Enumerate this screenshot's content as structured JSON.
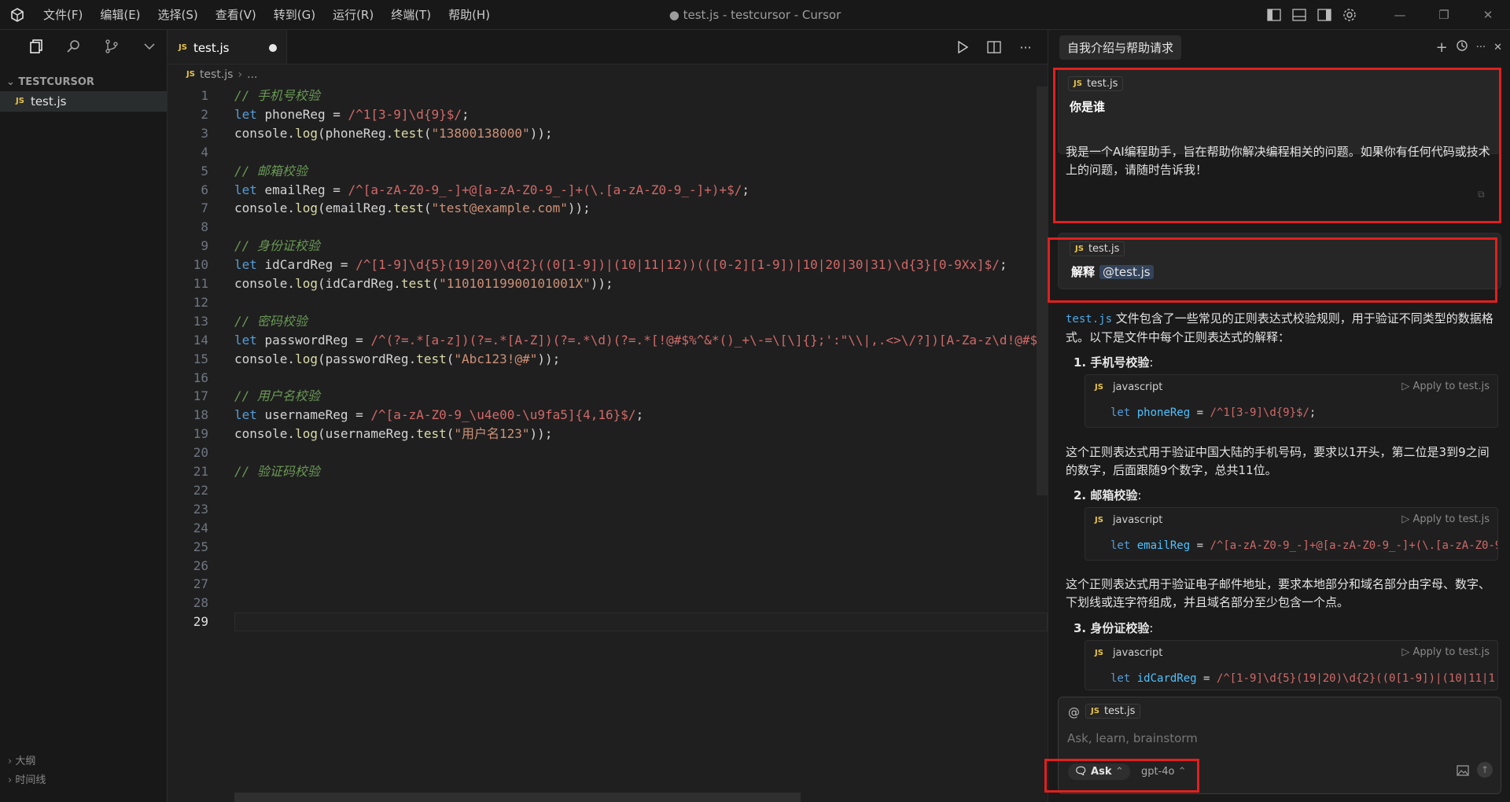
{
  "window": {
    "title": "● test.js - testcursor - Cursor"
  },
  "menu": [
    "文件(F)",
    "编辑(E)",
    "选择(S)",
    "查看(V)",
    "转到(G)",
    "运行(R)",
    "终端(T)",
    "帮助(H)"
  ],
  "sidebar": {
    "section": "TESTCURSOR",
    "file": "test.js",
    "bottom_outline": "大纲",
    "bottom_timeline": "时间线"
  },
  "editor": {
    "tab_label": "test.js",
    "breadcrumb_file": "test.js",
    "breadcrumb_more": "...",
    "file_badge": "JS",
    "current_line": "29",
    "lines": [
      {
        "n": "1",
        "html": "<span class=\"cmt\">// 手机号校验</span>"
      },
      {
        "n": "2",
        "html": "<span class=\"kw\">let</span> phoneReg = <span class=\"rx\">/^1[3-9]\\d{9}$/</span>;"
      },
      {
        "n": "3",
        "html": "console.<span class=\"fn\">log</span>(phoneReg.<span class=\"fn\">test</span>(<span class=\"str\">\"13800138000\"</span>));"
      },
      {
        "n": "4",
        "html": ""
      },
      {
        "n": "5",
        "html": "<span class=\"cmt\">// 邮箱校验</span>"
      },
      {
        "n": "6",
        "html": "<span class=\"kw\">let</span> emailReg = <span class=\"rx\">/^[a-zA-Z0-9_-]+@[a-zA-Z0-9_-]+(\\.[a-zA-Z0-9_-]+)+$/</span>;"
      },
      {
        "n": "7",
        "html": "console.<span class=\"fn\">log</span>(emailReg.<span class=\"fn\">test</span>(<span class=\"str\">\"test@example.com\"</span>));"
      },
      {
        "n": "8",
        "html": ""
      },
      {
        "n": "9",
        "html": "<span class=\"cmt\">// 身份证校验</span>"
      },
      {
        "n": "10",
        "html": "<span class=\"kw\">let</span> idCardReg = <span class=\"rx\">/^[1-9]\\d{5}(19|20)\\d{2}((0[1-9])|(10|11|12))(([0-2][1-9])|10|20|30|31)\\d{3}[0-9Xx]$/</span>;"
      },
      {
        "n": "11",
        "html": "console.<span class=\"fn\">log</span>(idCardReg.<span class=\"fn\">test</span>(<span class=\"str\">\"11010119900101001X\"</span>));"
      },
      {
        "n": "12",
        "html": ""
      },
      {
        "n": "13",
        "html": "<span class=\"cmt\">// 密码校验</span>"
      },
      {
        "n": "14",
        "html": "<span class=\"kw\">let</span> passwordReg = <span class=\"rx\">/^(?=.*[a-z])(?=.*[A-Z])(?=.*\\d)(?=.*[!@#$%^&amp;*()_+\\-=\\[\\]{};':\"\\\\|,.&lt;&gt;\\/?])[A-Za-z\\d!@#$%^</span>"
      },
      {
        "n": "15",
        "html": "console.<span class=\"fn\">log</span>(passwordReg.<span class=\"fn\">test</span>(<span class=\"str\">\"Abc123!@#\"</span>));"
      },
      {
        "n": "16",
        "html": ""
      },
      {
        "n": "17",
        "html": "<span class=\"cmt\">// 用户名校验</span>"
      },
      {
        "n": "18",
        "html": "<span class=\"kw\">let</span> usernameReg = <span class=\"rx\">/^[a-zA-Z0-9_\\u4e00-\\u9fa5]{4,16}$/</span>;"
      },
      {
        "n": "19",
        "html": "console.<span class=\"fn\">log</span>(usernameReg.<span class=\"fn\">test</span>(<span class=\"str\">\"用户名123\"</span>));"
      },
      {
        "n": "20",
        "html": ""
      },
      {
        "n": "21",
        "html": "<span class=\"cmt\">// 验证码校验</span>"
      },
      {
        "n": "22",
        "html": ""
      },
      {
        "n": "23",
        "html": ""
      },
      {
        "n": "24",
        "html": ""
      },
      {
        "n": "25",
        "html": ""
      },
      {
        "n": "26",
        "html": ""
      },
      {
        "n": "27",
        "html": ""
      },
      {
        "n": "28",
        "html": ""
      },
      {
        "n": "29",
        "html": ""
      }
    ]
  },
  "chat": {
    "title": "自我介绍与帮助请求",
    "msg1_file": "test.js",
    "msg1_question": "你是谁",
    "msg1_answer": "我是一个AI编程助手，旨在帮助你解决编程相关的问题。如果你有任何代码或技术上的问题，请随时告诉我！",
    "msg2_file": "test.js",
    "msg2_prefix": "解释",
    "msg2_mention": "@test.js",
    "answer_file": "test.js",
    "answer_intro": " 文件包含了一些常见的正则表达式校验规则，用于验证不同类型的数据格式。以下是文件中每个正则表达式的解释：",
    "item1_num": "1.",
    "item1_title": "手机号校验",
    "item1_colon": ":",
    "item2_num": "2.",
    "item2_title": "邮箱校验",
    "item2_colon": ":",
    "item3_num": "3.",
    "item3_title": "身份证校验",
    "item3_colon": ":",
    "code_lang": "javascript",
    "apply_label": "Apply to test.js",
    "code1": "<span class=\"kw\">let</span> <span style=\"color:#4fc1ff\">phoneReg</span> = <span class=\"rx\">/^1[3-9]\\d{9}$/</span>;",
    "code2": "<span class=\"kw\">let</span> <span style=\"color:#4fc1ff\">emailReg</span> = <span class=\"rx\">/^[a-zA-Z0-9_-]+@[a-zA-Z0-9_-]+(\\.[a-zA-Z0-9_-</span>",
    "code3": "<span class=\"kw\">let</span> <span style=\"color:#4fc1ff\">idCardReg</span> = <span class=\"rx\">/^[1-9]\\d{5}(19|20)\\d{2}((0[1-9])|(10|11|1</span>",
    "desc1": "这个正则表达式用于验证中国大陆的手机号码，要求以1开头，第二位是3到9之间的数字，后面跟随9个数字，总共11位。",
    "desc2": "这个正则表达式用于验证电子邮件地址，要求本地部分和域名部分由字母、数字、下划线或连字符组成，并且域名部分至少包含一个点。",
    "composer_file": "test.js",
    "composer_at": "@",
    "placeholder": "Ask, learn, brainstorm",
    "mode": "Ask",
    "model": "gpt-4o"
  },
  "colors": {
    "accent_red": "#e0201e",
    "js_badge": "#e8c44d"
  }
}
